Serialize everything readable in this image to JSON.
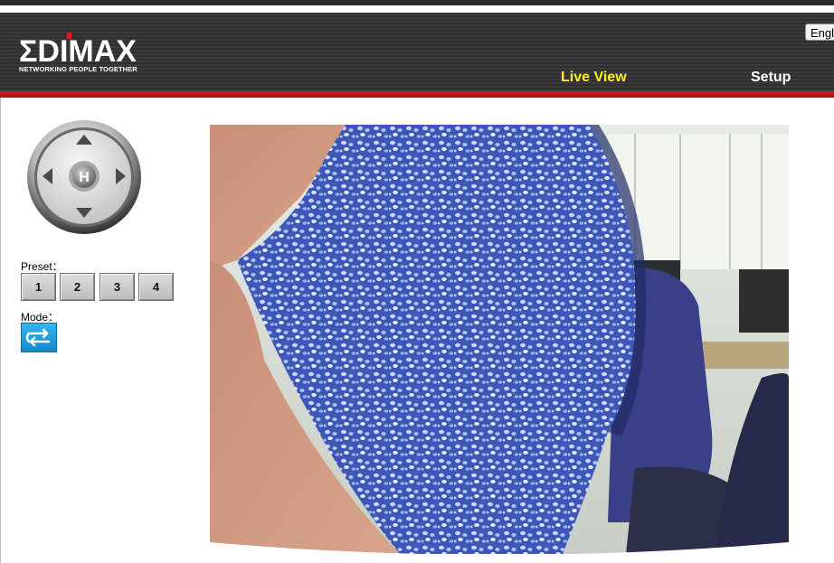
{
  "brand": {
    "name": "EDIMAX",
    "tagline": "NETWORKING PEOPLE TOGETHER",
    "accent_color": "#d81c1c"
  },
  "language_button": {
    "label": "Engl"
  },
  "nav": {
    "live_view": "Live View",
    "setup": "Setup",
    "active_color": "#ffee22"
  },
  "ptz": {
    "home_label": "H",
    "icons": [
      "arrow-up-icon",
      "arrow-down-icon",
      "arrow-left-icon",
      "arrow-right-icon"
    ]
  },
  "preset": {
    "label": "Preset：",
    "buttons": [
      "1",
      "2",
      "3",
      "4"
    ]
  },
  "mode": {
    "label": "Mode：",
    "icon": "mode-switch-icon"
  },
  "video": {
    "icon": "camera-feed-image"
  }
}
